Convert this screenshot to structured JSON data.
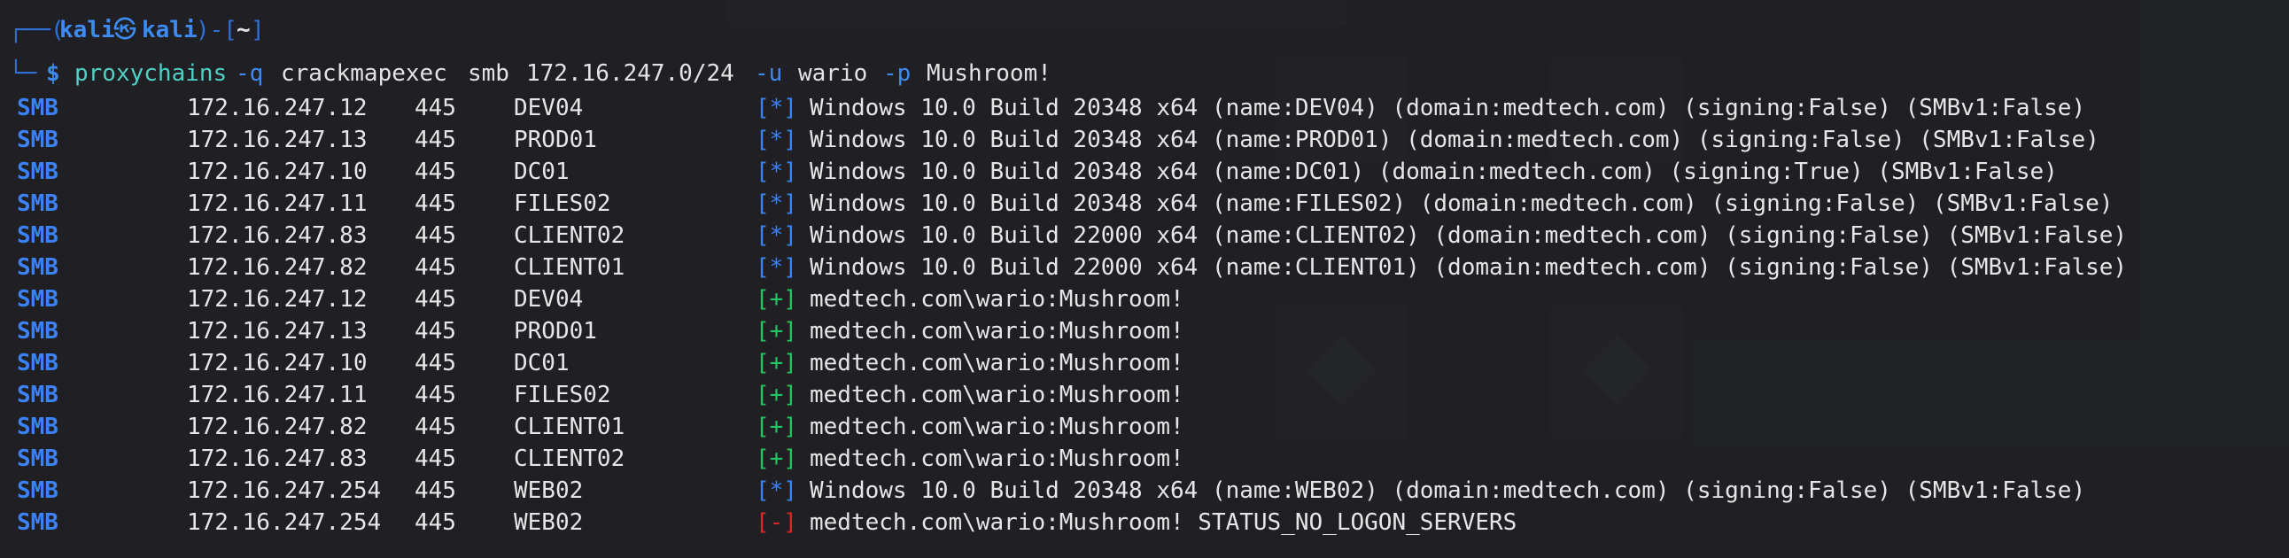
{
  "prompt": {
    "corner_top": "┌──(",
    "user": "kali",
    "at_glyph": "㉿",
    "host": "kali",
    "close_open": ")-[",
    "dir": "~",
    "close_bracket": "]",
    "corner_bottom": "└─",
    "dollar": "$",
    "command": "proxychains",
    "opt_q": "-q",
    "tool": "crackmapexec",
    "proto": "smb",
    "target": "172.16.247.0/24",
    "opt_u": "-u",
    "user_arg": "wario",
    "opt_p": "-p",
    "pass_arg": "Mushroom!"
  },
  "output": {
    "rows": [
      {
        "proto": "SMB",
        "ip": "172.16.247.12",
        "port": "445",
        "host": "DEV04",
        "bracket": "[*]",
        "status": "info",
        "msg": "Windows 10.0 Build 20348 x64 (name:DEV04) (domain:medtech.com) (signing:False) (SMBv1:False)"
      },
      {
        "proto": "SMB",
        "ip": "172.16.247.13",
        "port": "445",
        "host": "PROD01",
        "bracket": "[*]",
        "status": "info",
        "msg": "Windows 10.0 Build 20348 x64 (name:PROD01) (domain:medtech.com) (signing:False) (SMBv1:False)"
      },
      {
        "proto": "SMB",
        "ip": "172.16.247.10",
        "port": "445",
        "host": "DC01",
        "bracket": "[*]",
        "status": "info",
        "msg": "Windows 10.0 Build 20348 x64 (name:DC01) (domain:medtech.com) (signing:True) (SMBv1:False)"
      },
      {
        "proto": "SMB",
        "ip": "172.16.247.11",
        "port": "445",
        "host": "FILES02",
        "bracket": "[*]",
        "status": "info",
        "msg": "Windows 10.0 Build 20348 x64 (name:FILES02) (domain:medtech.com) (signing:False) (SMBv1:False)"
      },
      {
        "proto": "SMB",
        "ip": "172.16.247.83",
        "port": "445",
        "host": "CLIENT02",
        "bracket": "[*]",
        "status": "info",
        "msg": "Windows 10.0 Build 22000 x64 (name:CLIENT02) (domain:medtech.com) (signing:False) (SMBv1:False)"
      },
      {
        "proto": "SMB",
        "ip": "172.16.247.82",
        "port": "445",
        "host": "CLIENT01",
        "bracket": "[*]",
        "status": "info",
        "msg": "Windows 10.0 Build 22000 x64 (name:CLIENT01) (domain:medtech.com) (signing:False) (SMBv1:False)"
      },
      {
        "proto": "SMB",
        "ip": "172.16.247.12",
        "port": "445",
        "host": "DEV04",
        "bracket": "[+]",
        "status": "ok",
        "msg": "medtech.com\\wario:Mushroom!"
      },
      {
        "proto": "SMB",
        "ip": "172.16.247.13",
        "port": "445",
        "host": "PROD01",
        "bracket": "[+]",
        "status": "ok",
        "msg": "medtech.com\\wario:Mushroom!"
      },
      {
        "proto": "SMB",
        "ip": "172.16.247.10",
        "port": "445",
        "host": "DC01",
        "bracket": "[+]",
        "status": "ok",
        "msg": "medtech.com\\wario:Mushroom!"
      },
      {
        "proto": "SMB",
        "ip": "172.16.247.11",
        "port": "445",
        "host": "FILES02",
        "bracket": "[+]",
        "status": "ok",
        "msg": "medtech.com\\wario:Mushroom!"
      },
      {
        "proto": "SMB",
        "ip": "172.16.247.82",
        "port": "445",
        "host": "CLIENT01",
        "bracket": "[+]",
        "status": "ok",
        "msg": "medtech.com\\wario:Mushroom!"
      },
      {
        "proto": "SMB",
        "ip": "172.16.247.83",
        "port": "445",
        "host": "CLIENT02",
        "bracket": "[+]",
        "status": "ok",
        "msg": "medtech.com\\wario:Mushroom!"
      },
      {
        "proto": "SMB",
        "ip": "172.16.247.254",
        "port": "445",
        "host": "WEB02",
        "bracket": "[*]",
        "status": "info",
        "msg": "Windows 10.0 Build 20348 x64 (name:WEB02) (domain:medtech.com) (signing:False) (SMBv1:False)"
      },
      {
        "proto": "SMB",
        "ip": "172.16.247.254",
        "port": "445",
        "host": "WEB02",
        "bracket": "[-]",
        "status": "error",
        "msg": "medtech.com\\wario:Mushroom! STATUS_NO_LOGON_SERVERS"
      }
    ]
  },
  "colors": {
    "info": "#3b82f6",
    "ok": "#22c55e",
    "error": "#dc2626",
    "background": "#262729"
  }
}
